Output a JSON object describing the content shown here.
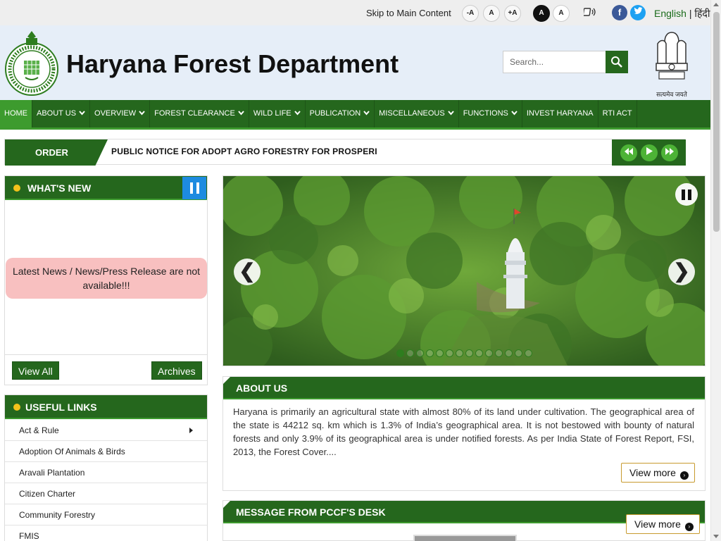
{
  "topbar": {
    "skip_link": "Skip to Main Content",
    "font_buttons": [
      "-A",
      "A",
      "+A"
    ],
    "contrast_buttons": [
      "A",
      "A"
    ],
    "screen_reader_icon": "speaker-icon",
    "social": [
      "facebook",
      "twitter"
    ],
    "lang_english": "English",
    "lang_sep": "|",
    "lang_hindi": "हिंदी"
  },
  "header": {
    "title": "Haryana Forest Department",
    "search_placeholder": "Search...",
    "emblem_motto": "सत्यमेव जयते"
  },
  "nav": {
    "items": [
      {
        "label": "HOME",
        "active": true,
        "dropdown": false
      },
      {
        "label": "ABOUT US",
        "dropdown": true
      },
      {
        "label": "OVERVIEW",
        "dropdown": true
      },
      {
        "label": "FOREST CLEARANCE",
        "dropdown": true
      },
      {
        "label": "WILD LIFE",
        "dropdown": true
      },
      {
        "label": "PUBLICATION",
        "dropdown": true
      },
      {
        "label": "MISCELLANEOUS",
        "dropdown": true
      },
      {
        "label": "FUNCTIONS",
        "dropdown": true
      },
      {
        "label": "INVEST HARYANA",
        "dropdown": false
      },
      {
        "label": "RTI ACT",
        "dropdown": false
      }
    ]
  },
  "ticker": {
    "label": "ORDER",
    "text": "PUBLIC NOTICE FOR ADOPT AGRO FORESTRY FOR PROSPERI"
  },
  "whats_new": {
    "title": "WHAT'S NEW",
    "message": "Latest News / News/Press Release are not available!!!",
    "view_all": "View All",
    "archives": "Archives"
  },
  "useful_links": {
    "title": "USEFUL LINKS",
    "items": [
      {
        "label": "Act & Rule",
        "has_submenu": true
      },
      {
        "label": "Adoption Of Animals & Birds"
      },
      {
        "label": "Aravali Plantation"
      },
      {
        "label": "Citizen Charter"
      },
      {
        "label": "Community Forestry"
      },
      {
        "label": "FMIS"
      }
    ]
  },
  "slider": {
    "prev": "❮",
    "next": "❯",
    "slide_count": 14,
    "active_slide": 1
  },
  "about": {
    "title": "ABOUT US",
    "text": "Haryana is primarily an agricultural state with almost 80% of its land under cultivation. The geographical area of the state is 44212 sq. km which is 1.3% of India’s geographical area. It is not bestowed with bounty of natural forests and only 3.9% of its geographical area is under notified forests. As per India State of Forest Report, FSI, 2013, the Forest Cover....",
    "view_more": "View more"
  },
  "pccf": {
    "title": "MESSAGE FROM PCCF'S DESK",
    "view_more": "View more"
  },
  "colors": {
    "nav_green": "#25671d",
    "accent_green": "#3d9b2e",
    "header_bg": "#e6eef8",
    "alert_pink": "#f8c0c0"
  }
}
